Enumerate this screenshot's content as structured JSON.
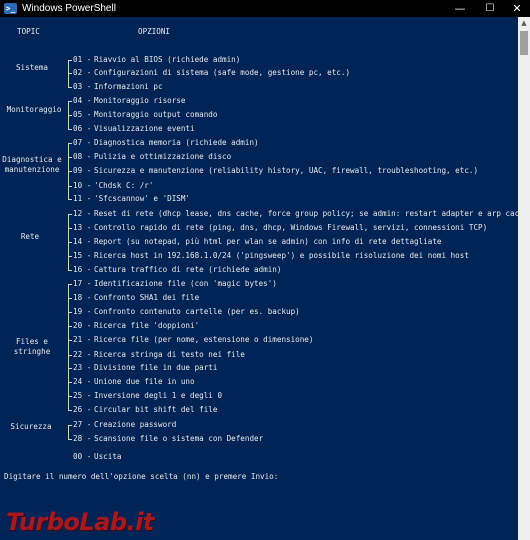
{
  "window": {
    "title": "Windows PowerShell",
    "icon_name": "powershell-icon",
    "minimize_glyph": "—",
    "maximize_glyph": "☐",
    "close_glyph": "✕"
  },
  "colors": {
    "console_background": "#012456",
    "console_text": "#e8e8e8",
    "titlebar_background": "#000000"
  },
  "menu": {
    "header_topic": "TOPIC",
    "header_options": "OPZIONI",
    "categories": [
      {
        "id": "sistema",
        "label": "Sistema"
      },
      {
        "id": "monitoraggio",
        "label": "Monitoraggio"
      },
      {
        "id": "diagnostica",
        "label": "Diagnostica e\nmanutenzione"
      },
      {
        "id": "rete",
        "label": "Rete"
      },
      {
        "id": "files",
        "label": "Files e\nstringhe"
      },
      {
        "id": "sicurezza",
        "label": "Sicurezza"
      }
    ],
    "options": [
      {
        "num": "01",
        "text": "Riavvio al BIOS (richiede admin)"
      },
      {
        "num": "02",
        "text": "Configurazioni di sistema (safe mode, gestione pc, etc.)"
      },
      {
        "num": "03",
        "text": "Informazioni pc"
      },
      {
        "num": "04",
        "text": "Monitoraggio risorse"
      },
      {
        "num": "05",
        "text": "Monitoraggio output comando"
      },
      {
        "num": "06",
        "text": "Visualizzazione eventi"
      },
      {
        "num": "07",
        "text": "Diagnostica memoria (richiede admin)"
      },
      {
        "num": "08",
        "text": "Pulizia e ottimizzazione disco"
      },
      {
        "num": "09",
        "text": "Sicurezza e manutenzione (reliability history, UAC, firewall, troubleshooting, etc.)"
      },
      {
        "num": "10",
        "text": "'Chdsk C: /r'"
      },
      {
        "num": "11",
        "text": "'Sfcscannow' e 'DISM'"
      },
      {
        "num": "12",
        "text": "Reset di rete (dhcp lease, dns cache, force group policy; se admin: restart adapter e arp cache)"
      },
      {
        "num": "13",
        "text": "Controllo rapido di rete (ping, dns, dhcp, Windows Firewall, servizi, connessioni TCP)"
      },
      {
        "num": "14",
        "text": "Report (su notepad, più html per wlan se admin) con info di rete dettagliate"
      },
      {
        "num": "15",
        "text": "Ricerca host in 192.168.1.0/24 ('pingsweep') e possibile risoluzione dei nomi host"
      },
      {
        "num": "16",
        "text": "Cattura traffico di rete (richiede admin)"
      },
      {
        "num": "17",
        "text": "Identificazione file (con 'magic bytes')"
      },
      {
        "num": "18",
        "text": "Confronto SHA1 dei file"
      },
      {
        "num": "19",
        "text": "Confronto contenuto cartelle (per es. backup)"
      },
      {
        "num": "20",
        "text": "Ricerca file 'doppioni'"
      },
      {
        "num": "21",
        "text": "Ricerca file (per nome, estensione o dimensione)"
      },
      {
        "num": "22",
        "text": "Ricerca stringa di testo nei file"
      },
      {
        "num": "23",
        "text": "Divisione file in due parti"
      },
      {
        "num": "24",
        "text": "Unione due file in uno"
      },
      {
        "num": "25",
        "text": "Inversione degli 1 e degli 0"
      },
      {
        "num": "26",
        "text": "Circular bit shift del file"
      },
      {
        "num": "27",
        "text": "Creazione password"
      },
      {
        "num": "28",
        "text": "Scansione file o sistema con Defender"
      }
    ],
    "exit": {
      "num": "00",
      "text": "Uscita"
    },
    "separator": " - "
  },
  "prompt": "Digitare il numero dell'opzione scelta (nn) e premere Invio:",
  "watermark": "TurboLab.it"
}
